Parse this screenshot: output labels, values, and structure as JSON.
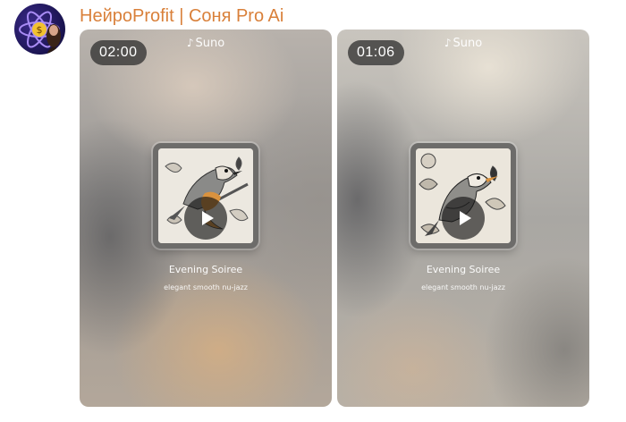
{
  "channel": {
    "name": "НейроProfit | Соня Pro Ai",
    "name_color": "#d9803a",
    "avatar_icon": "atom-dollar-avatar"
  },
  "videos": [
    {
      "duration": "02:00",
      "brand": "Suno",
      "brand_icon": "music-note-icon",
      "song_title": "Evening Soiree",
      "song_style": "elegant smooth nu-jazz",
      "cover_icon": "bird-illustration"
    },
    {
      "duration": "01:06",
      "brand": "Suno",
      "brand_icon": "music-note-icon",
      "song_title": "Evening Soiree",
      "song_style": "elegant smooth nu-jazz",
      "cover_icon": "bird-illustration"
    }
  ]
}
